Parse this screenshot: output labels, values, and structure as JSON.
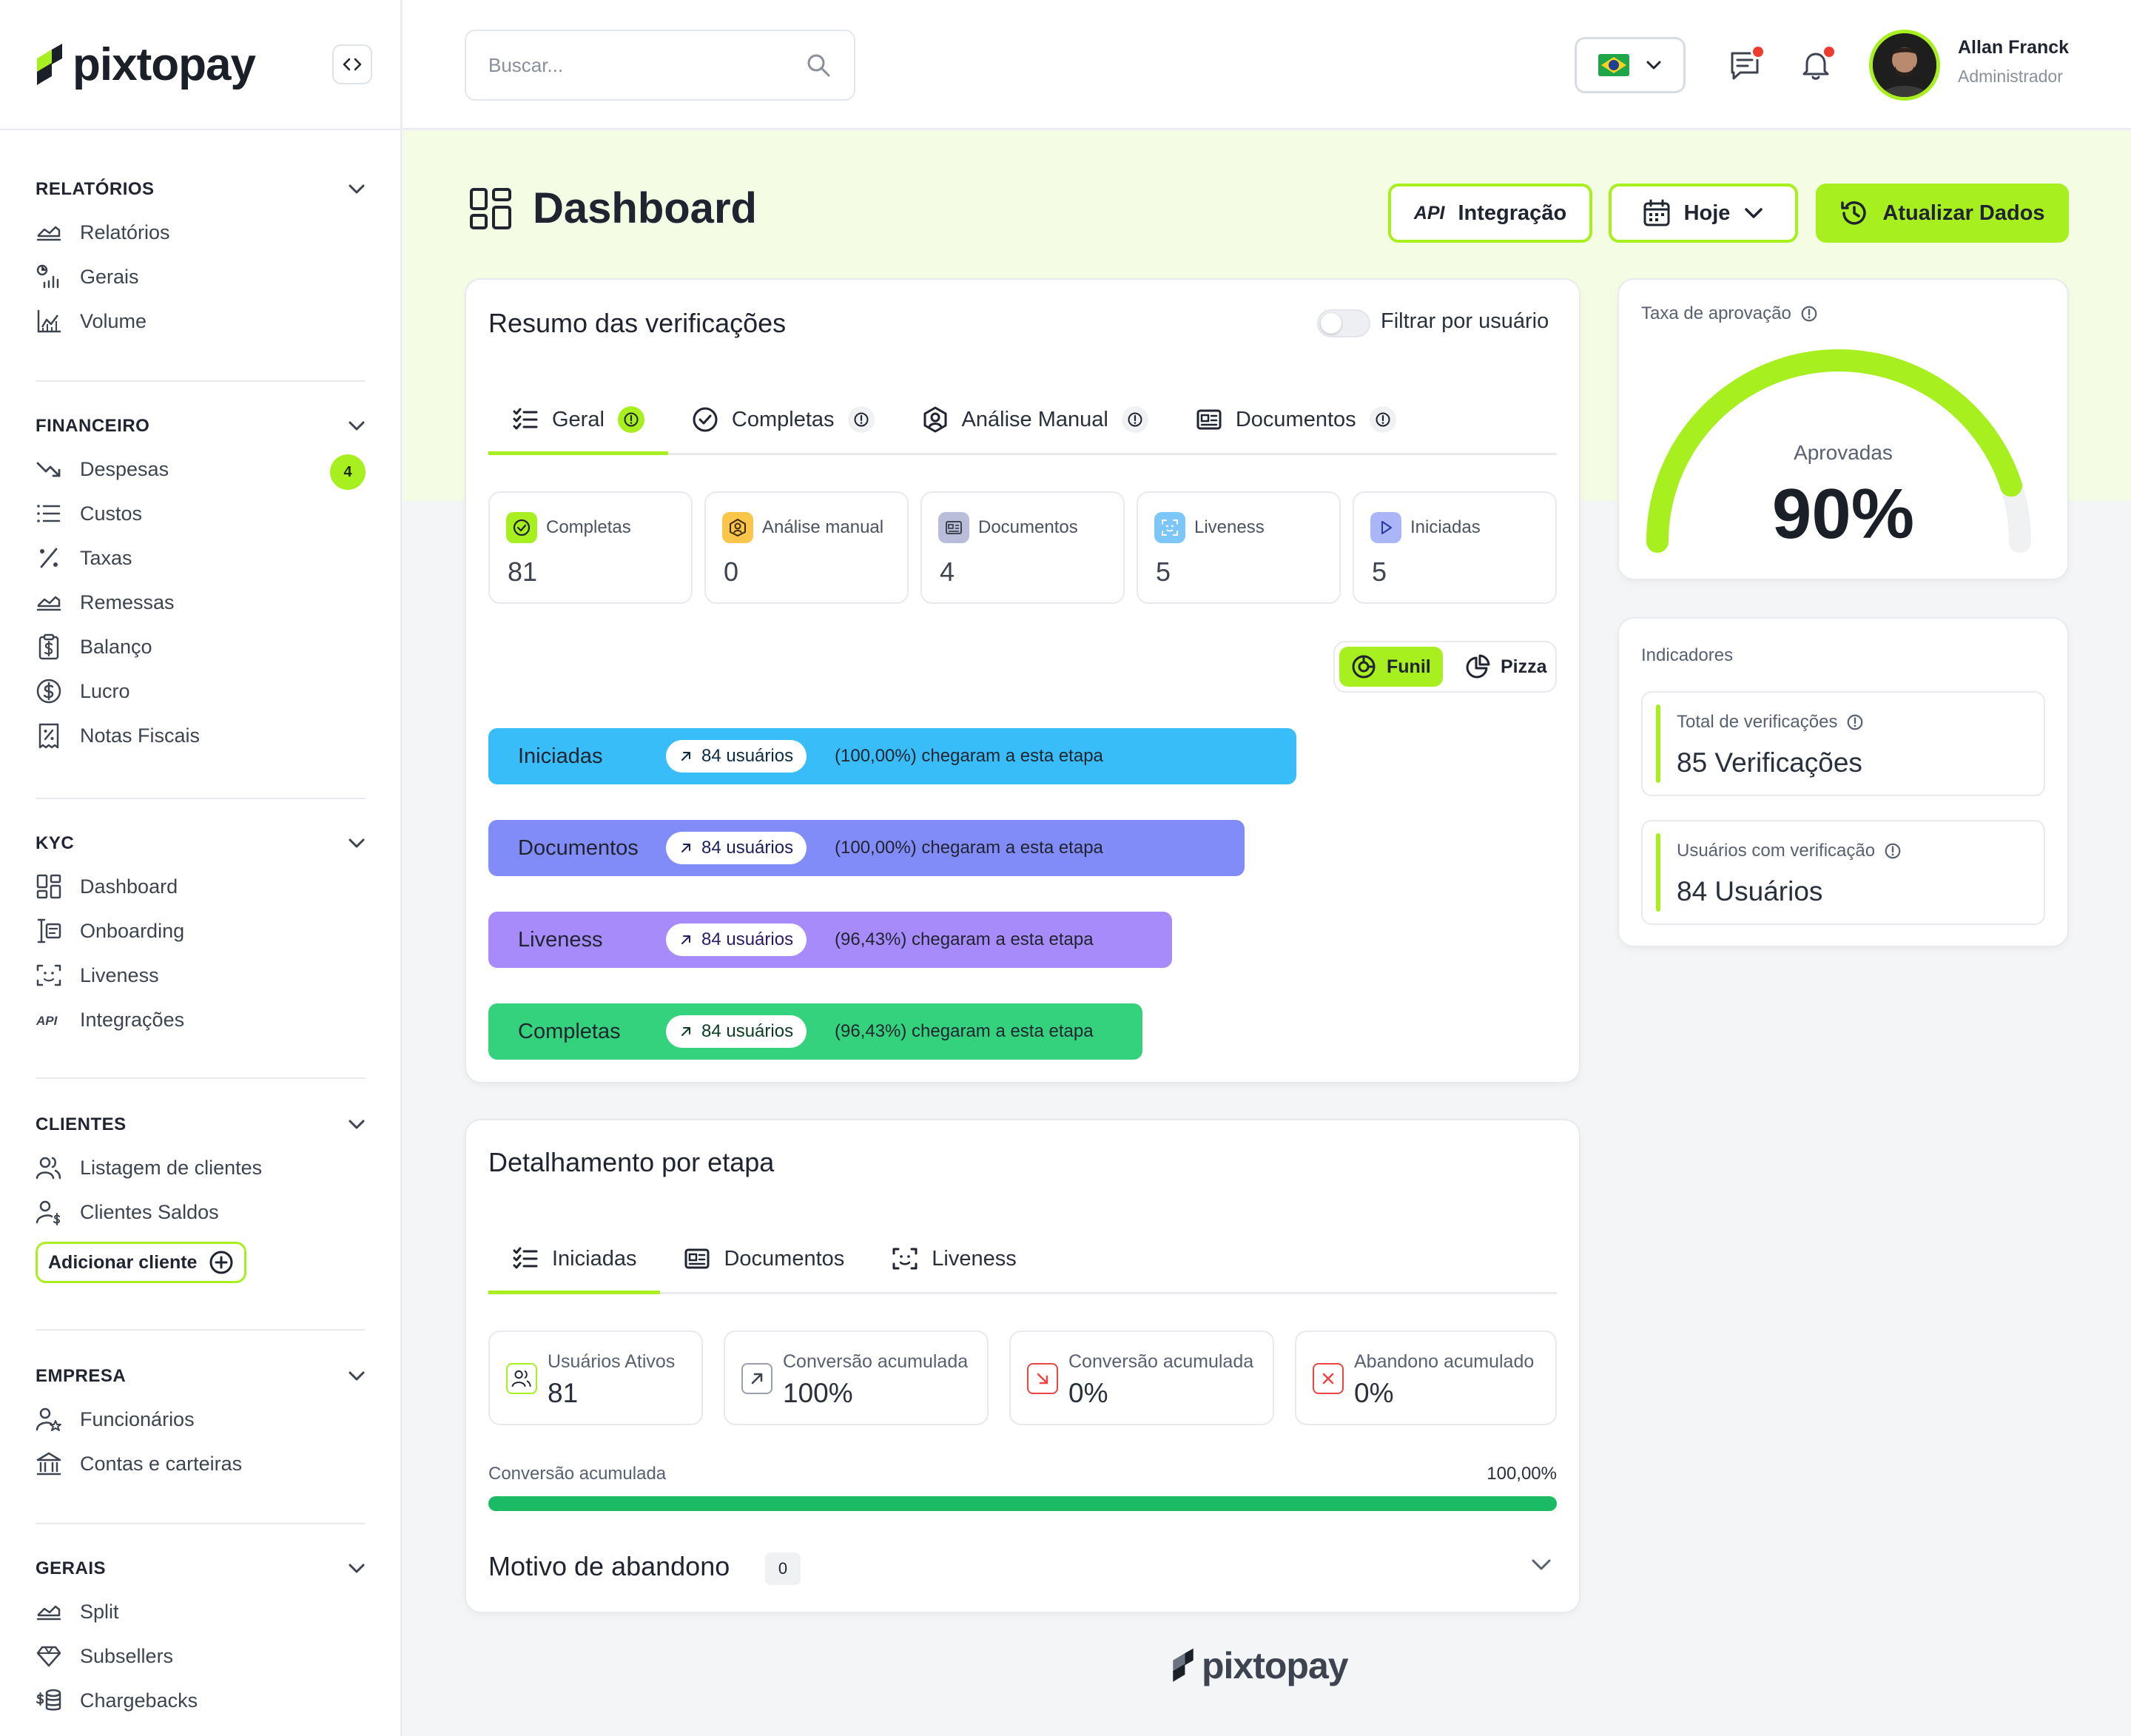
{
  "brand": {
    "name": "pixtopay",
    "accent": "#a8ef1f"
  },
  "sidebar": {
    "sections": [
      {
        "title": "RELATÓRIOS",
        "items": [
          {
            "label": "Relatórios",
            "icon": "chart-area-icon"
          },
          {
            "label": "Gerais",
            "icon": "chart-bars-icon"
          },
          {
            "label": "Volume",
            "icon": "chart-volume-icon"
          }
        ]
      },
      {
        "title": "FINANCEIRO",
        "items": [
          {
            "label": "Despesas",
            "icon": "trend-down-icon",
            "badge": "4"
          },
          {
            "label": "Custos",
            "icon": "list-icon"
          },
          {
            "label": "Taxas",
            "icon": "percent-icon"
          },
          {
            "label": "Remessas",
            "icon": "chart-area-icon"
          },
          {
            "label": "Balanço",
            "icon": "clipboard-dollar-icon"
          },
          {
            "label": "Lucro",
            "icon": "dollar-circle-icon"
          },
          {
            "label": "Notas Fiscais",
            "icon": "receipt-icon"
          }
        ]
      },
      {
        "title": "KYC",
        "items": [
          {
            "label": "Dashboard",
            "icon": "dashboard-icon"
          },
          {
            "label": "Onboarding",
            "icon": "onboarding-icon"
          },
          {
            "label": "Liveness",
            "icon": "face-scan-icon"
          },
          {
            "label": "Integrações",
            "icon": "api-icon"
          }
        ]
      },
      {
        "title": "CLIENTES",
        "items": [
          {
            "label": "Listagem de clientes",
            "icon": "users-icon"
          },
          {
            "label": "Clientes Saldos",
            "icon": "user-dollar-icon"
          }
        ],
        "action": "Adicionar cliente"
      },
      {
        "title": "EMPRESA",
        "items": [
          {
            "label": "Funcionários",
            "icon": "user-star-icon"
          },
          {
            "label": "Contas e carteiras",
            "icon": "bank-icon"
          }
        ]
      },
      {
        "title": "GERAIS",
        "items": [
          {
            "label": "Split",
            "icon": "chart-area-icon"
          },
          {
            "label": "Subsellers",
            "icon": "diamond-icon"
          },
          {
            "label": "Chargebacks",
            "icon": "coins-icon"
          }
        ]
      }
    ]
  },
  "header": {
    "search_placeholder": "Buscar...",
    "user_name": "Allan Franck",
    "user_role": "Administrador",
    "language": "Português (Brasil)"
  },
  "page": {
    "title": "Dashboard",
    "btn_api_tag": "API",
    "btn_api": "Integração",
    "btn_date": "Hoje",
    "btn_refresh": "Atualizar Dados"
  },
  "summary": {
    "title": "Resumo das verificações",
    "filter_label": "Filtrar por usuário",
    "tabs": [
      "Geral",
      "Completas",
      "Análise Manual",
      "Documentos"
    ],
    "stats": [
      {
        "label": "Completas",
        "value": "81",
        "color": "#a8ef1f"
      },
      {
        "label": "Análise manual",
        "value": "0",
        "color": "#f9c54a"
      },
      {
        "label": "Documentos",
        "value": "4",
        "color": "#b9bdd9"
      },
      {
        "label": "Liveness",
        "value": "5",
        "color": "#7cc7f7"
      },
      {
        "label": "Iniciadas",
        "value": "5",
        "color": "#aab6f7"
      }
    ],
    "view_funnel": "Funil",
    "view_pie": "Pizza",
    "funnel": [
      {
        "label": "Iniciadas",
        "users": "84 usuários",
        "text": "(100,00%) chegaram a esta etapa",
        "color": "#38bdf8",
        "pct": 100
      },
      {
        "label": "Documentos",
        "users": "84 usuários",
        "text": "(100,00%) chegaram a esta etapa",
        "color": "#818cf8",
        "pct": 100
      },
      {
        "label": "Liveness",
        "users": "84 usuários",
        "text": "(96,43%) chegaram a esta etapa",
        "color": "#a78bfa",
        "pct": 96.43
      },
      {
        "label": "Completas",
        "users": "84 usuários",
        "text": "(96,43%) chegaram a esta etapa",
        "color": "#34d27d",
        "pct": 96.43
      }
    ]
  },
  "approval": {
    "title": "Taxa de aprovação",
    "label": "Aprovadas",
    "value": "90%",
    "rate": 0.9
  },
  "indicators": {
    "title": "Indicadores",
    "items": [
      {
        "label": "Total de verificações",
        "value": "85 Verificações"
      },
      {
        "label": "Usuários com verificação",
        "value": "84 Usuários"
      }
    ]
  },
  "detail": {
    "title": "Detalhamento por etapa",
    "tabs": [
      "Iniciadas",
      "Documentos",
      "Liveness"
    ],
    "stats": [
      {
        "label": "Usuários Ativos",
        "value": "81",
        "icon": "users-icon",
        "color": "#a8ef1f"
      },
      {
        "label": "Conversão acumulada",
        "value": "100%",
        "icon": "arrow-up-right-icon",
        "color": "#9aa0aa"
      },
      {
        "label": "Conversão acumulada",
        "value": "0%",
        "icon": "arrow-down-right-icon",
        "color": "#ef4444"
      },
      {
        "label": "Abandono acumulado",
        "value": "0%",
        "icon": "x-icon",
        "color": "#ef4444"
      }
    ],
    "progress_label": "Conversão acumulada",
    "progress_value": "100,00%",
    "progress": 1.0,
    "abandon_title": "Motivo de abandono",
    "abandon_count": "0"
  }
}
